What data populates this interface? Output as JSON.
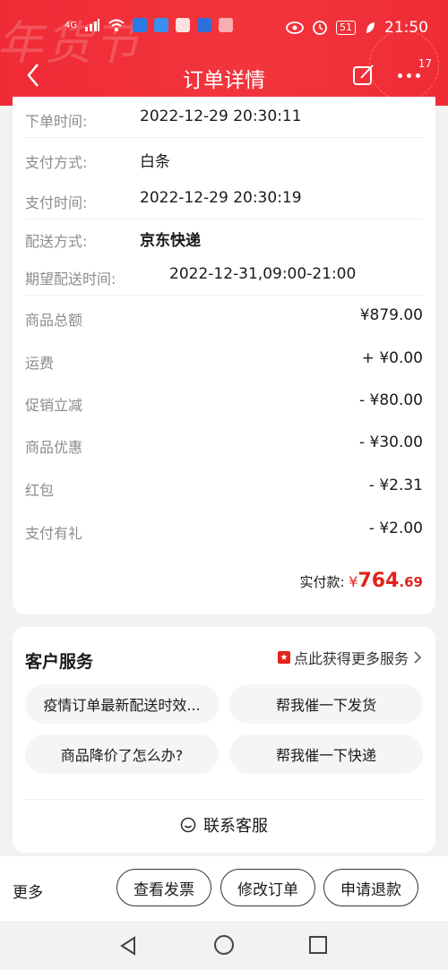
{
  "status_bar": {
    "network": "4G",
    "time": "21:50",
    "battery": "51"
  },
  "header": {
    "title": "订单详情",
    "decor_text": "年货节",
    "more_badge": "17"
  },
  "order_info": [
    {
      "label": "下单时间:",
      "value": "2022-12-29 20:30:11"
    },
    {
      "label": "支付方式:",
      "value": "白条"
    },
    {
      "label": "支付时间:",
      "value": "2022-12-29 20:30:19"
    },
    {
      "label": "配送方式:",
      "value": "京东快递"
    },
    {
      "label": "期望配送时间:",
      "value": "2022-12-31,09:00-21:00"
    }
  ],
  "amounts": [
    {
      "label": "商品总额",
      "value": "¥879.00"
    },
    {
      "label": "运费",
      "value": "+ ¥0.00"
    },
    {
      "label": "促销立减",
      "value": "- ¥80.00"
    },
    {
      "label": "商品优惠",
      "value": "- ¥30.00"
    },
    {
      "label": "红包",
      "value": "- ¥2.31"
    },
    {
      "label": "支付有礼",
      "value": "- ¥2.00"
    }
  ],
  "total": {
    "label": "实付款:",
    "currency": "¥",
    "integer": "764",
    "decimal": ".69"
  },
  "customer_service": {
    "title": "客户服务",
    "more_link": "点此获得更多服务",
    "options": [
      "疫情订单最新配送时效...",
      "帮我催一下发货",
      "商品降价了怎么办?",
      "帮我催一下快递"
    ],
    "contact": "联系客服"
  },
  "bottom_bar": {
    "more": "更多",
    "buttons": [
      "查看发票",
      "修改订单",
      "申请退款"
    ]
  },
  "colors": {
    "brand_red": "#f02b36",
    "price_red": "#e2231a"
  }
}
